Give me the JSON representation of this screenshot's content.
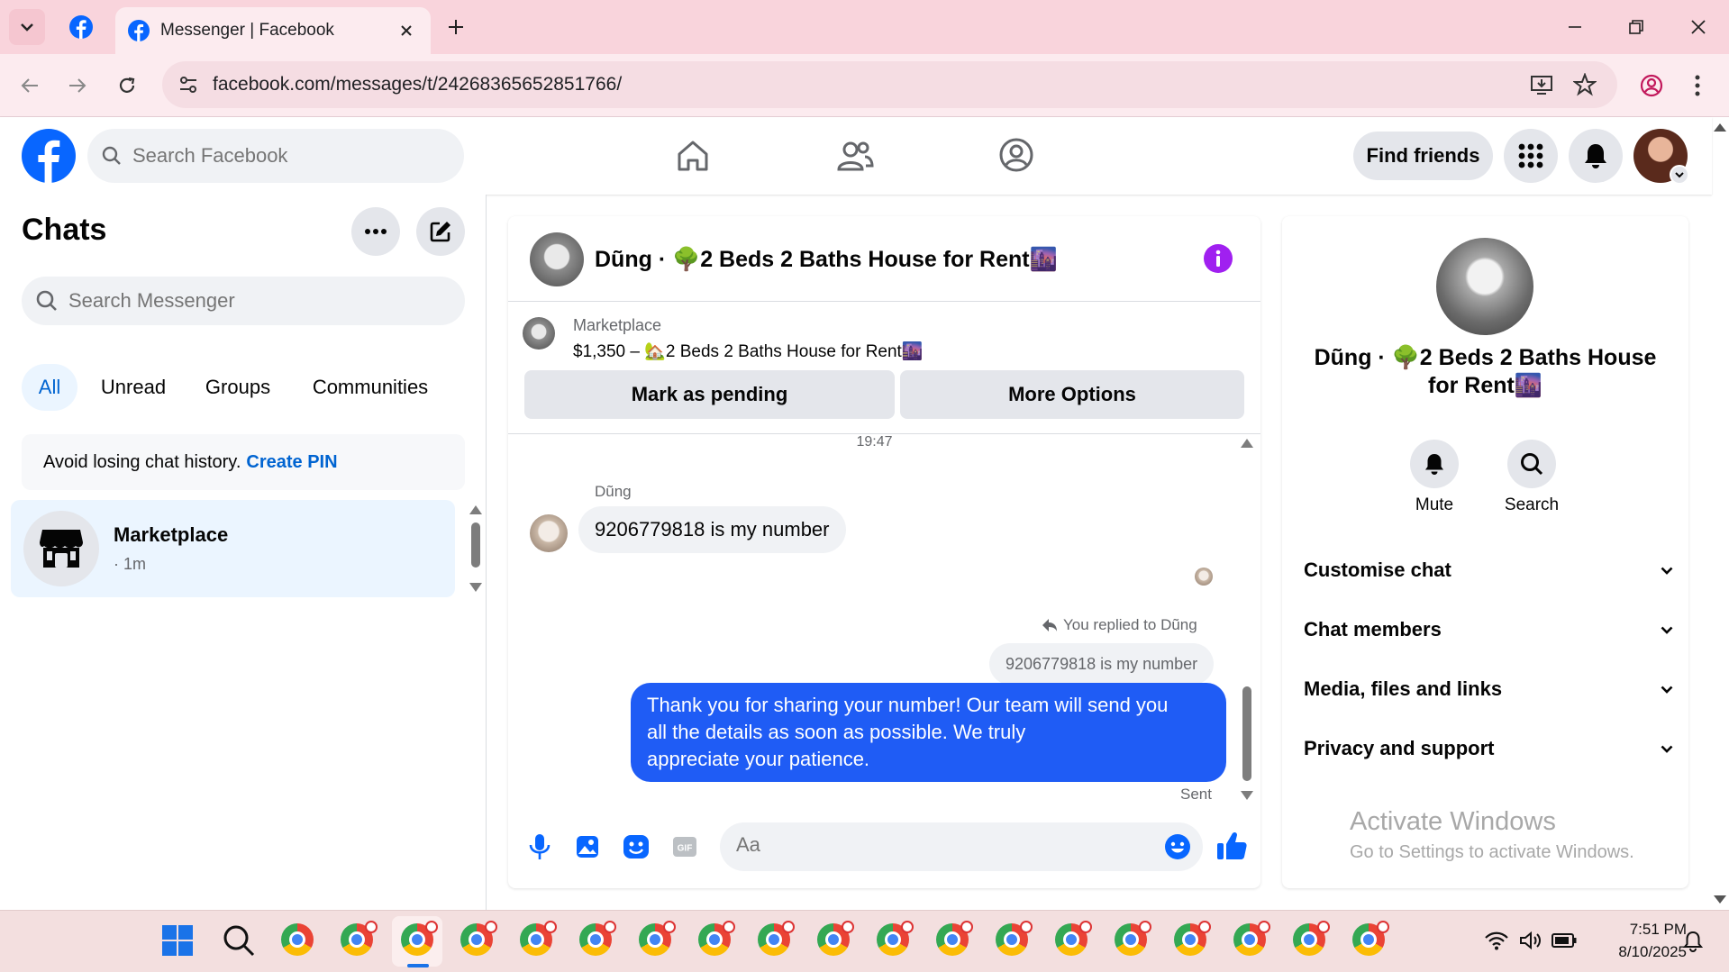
{
  "browser": {
    "tab_title": "Messenger | Facebook",
    "url": "facebook.com/messages/t/24268365652851766/"
  },
  "fb_header": {
    "search_placeholder": "Search Facebook",
    "find_friends_label": "Find friends"
  },
  "sidebar": {
    "title": "Chats",
    "search_placeholder": "Search Messenger",
    "filters": [
      "All",
      "Unread",
      "Groups",
      "Communities"
    ],
    "pin_notice": "Avoid losing chat history.",
    "pin_link": "Create PIN",
    "chats": [
      {
        "name": "Marketplace",
        "meta": "· 1m"
      }
    ]
  },
  "conversation": {
    "header_title": "Dũng · 🌳2 Beds 2 Baths House for Rent🌆",
    "listing_source": "Marketplace",
    "listing_price_title": "$1,350 – 🏡2 Beds 2 Baths House for Rent🌆",
    "mark_pending_label": "Mark as pending",
    "more_options_label": "More Options",
    "timestamp": "19:47",
    "sender_name": "Dũng",
    "incoming_message": "9206779818 is my number",
    "reply_notice": "You replied to Dũng",
    "quoted_message": "9206779818 is my number",
    "outgoing_lines": [
      "Thank you for sharing your number!  Our team will send you",
      "all the details as soon as possible. We truly",
      "appreciate your patience."
    ],
    "sent_status": "Sent",
    "composer_placeholder": "Aa"
  },
  "details": {
    "title": "Dũng · 🌳2 Beds 2 Baths House for Rent🌆",
    "mute_label": "Mute",
    "search_label": "Search",
    "sections": [
      "Customise chat",
      "Chat members",
      "Media, files and links",
      "Privacy and support"
    ],
    "watermark_title": "Activate Windows",
    "watermark_sub": "Go to Settings to activate Windows."
  },
  "taskbar": {
    "time": "7:51 PM",
    "date": "8/10/2025"
  },
  "colors": {
    "fb_blue": "#0866ff",
    "messenger_blue": "#1f5cf5",
    "info_purple": "#a020f0",
    "tab_bar": "#f9d4dc"
  }
}
